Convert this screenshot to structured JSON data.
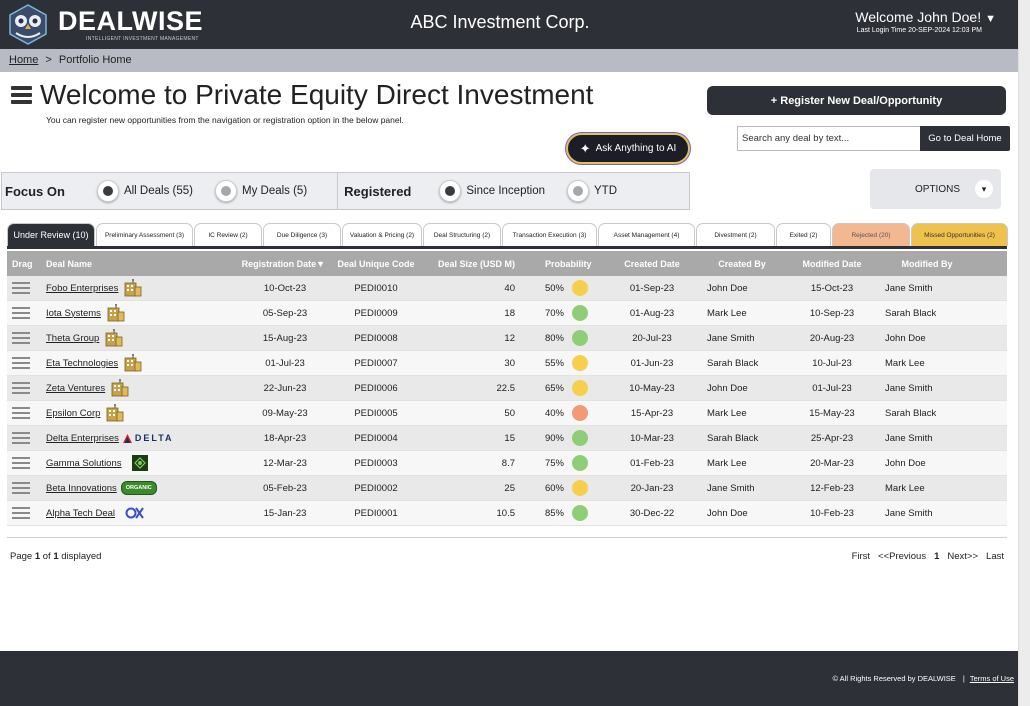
{
  "header": {
    "brand": "DEALWISE",
    "tagline": "INTELLIGENT INVESTMENT MANAGEMENT",
    "company": "ABC Investment Corp.",
    "welcome": "Welcome John Doe!",
    "last_login": "Last Login Time 20-SEP-2024 12:03 PM"
  },
  "breadcrumb": {
    "home": "Home",
    "separator": ">",
    "current": "Portfolio Home"
  },
  "page": {
    "title": "Welcome to Private Equity Direct Investment",
    "subtitle": "You can register new opportunities from the navigation or registration option in the below panel."
  },
  "actions": {
    "register": "+ Register New Deal/Opportunity",
    "search_placeholder": "Search any deal by text...",
    "goto": "Go to Deal Home",
    "ask_ai": "Ask Anything to AI",
    "options": "OPTIONS"
  },
  "filters": {
    "focus_label": "Focus On",
    "all_deals": "All Deals (55)",
    "my_deals": "My Deals (5)",
    "registered_label": "Registered",
    "since_inception": "Since Inception",
    "ytd": "YTD"
  },
  "tabs": [
    "Under Review (10)",
    "Preliminary Assessment (3)",
    "IC Review (2)",
    "Due Diligence (3)",
    "Valuation & Pricing (2)",
    "Deal Structuring (2)",
    "Transaction Execution (3)",
    "Asset Management (4)",
    "Divestment (2)",
    "Exited (2)",
    "Rejected (20)",
    "Missed Opportunities (2)"
  ],
  "table": {
    "columns": [
      "Drag",
      "Deal Name",
      "Registration Date▼",
      "Deal Unique Code",
      "Deal Size (USD M)",
      "Probability",
      "Created Date",
      "Created By",
      "Modified Date",
      "Modified By"
    ],
    "rows": [
      {
        "name": "Fobo Enterprises",
        "logo": "building-icon",
        "reg": "10-Oct-23",
        "code": "PEDI0010",
        "size": "40",
        "prob": "50%",
        "status": "#f6d04d",
        "created": "01-Sep-23",
        "created_by": "John Doe",
        "modified": "15-Oct-23",
        "modified_by": "Jane Smith"
      },
      {
        "name": "Iota Systems",
        "logo": "building-icon",
        "reg": "05-Sep-23",
        "code": "PEDI0009",
        "size": "18",
        "prob": "70%",
        "status": "#8fce77",
        "created": "01-Aug-23",
        "created_by": "Mark Lee",
        "modified": "10-Sep-23",
        "modified_by": "Sarah Black"
      },
      {
        "name": "Theta Group",
        "logo": "building-icon",
        "reg": "15-Aug-23",
        "code": "PEDI0008",
        "size": "12",
        "prob": "80%",
        "status": "#8fce77",
        "created": "20-Jul-23",
        "created_by": "Jane Smith",
        "modified": "20-Aug-23",
        "modified_by": "John Doe"
      },
      {
        "name": "Eta Technologies",
        "logo": "building-icon",
        "reg": "01-Jul-23",
        "code": "PEDI0007",
        "size": "30",
        "prob": "55%",
        "status": "#f6d04d",
        "created": "01-Jun-23",
        "created_by": "Sarah Black",
        "modified": "10-Jul-23",
        "modified_by": "Mark Lee"
      },
      {
        "name": "Zeta Ventures",
        "logo": "building-icon",
        "reg": "22-Jun-23",
        "code": "PEDI0006",
        "size": "22.5",
        "prob": "65%",
        "status": "#f6d04d",
        "created": "10-May-23",
        "created_by": "John Doe",
        "modified": "01-Jul-23",
        "modified_by": "Jane Smith"
      },
      {
        "name": "Epsilon Corp",
        "logo": "building-icon",
        "reg": "09-May-23",
        "code": "PEDI0005",
        "size": "50",
        "prob": "40%",
        "status": "#f19a74",
        "created": "15-Apr-23",
        "created_by": "Mark Lee",
        "modified": "15-May-23",
        "modified_by": "Sarah Black"
      },
      {
        "name": "Delta Enterprises",
        "logo": "delta-logo",
        "logo_text": "DELTA",
        "reg": "18-Apr-23",
        "code": "PEDI0004",
        "size": "15",
        "prob": "90%",
        "status": "#8fce77",
        "created": "10-Mar-23",
        "created_by": "Sarah Black",
        "modified": "25-Apr-23",
        "modified_by": "Jane Smith"
      },
      {
        "name": "Gamma Solutions",
        "logo": "gamma-logo",
        "reg": "12-Mar-23",
        "code": "PEDI0003",
        "size": "8.7",
        "prob": "75%",
        "status": "#8fce77",
        "created": "01-Feb-23",
        "created_by": "Mark Lee",
        "modified": "20-Mar-23",
        "modified_by": "John Doe"
      },
      {
        "name": "Beta Innovations",
        "logo": "organic-logo",
        "logo_text": "ORGANIC",
        "reg": "05-Feb-23",
        "code": "PEDI0002",
        "size": "25",
        "prob": "60%",
        "status": "#f6d04d",
        "created": "20-Jan-23",
        "created_by": "Jane Smith",
        "modified": "12-Feb-23",
        "modified_by": "Mark Lee"
      },
      {
        "name": "Alpha Tech Deal",
        "logo": "ox-logo",
        "reg": "15-Jan-23",
        "code": "PEDI0001",
        "size": "10.5",
        "prob": "85%",
        "status": "#8fce77",
        "created": "30-Dec-22",
        "created_by": "John Doe",
        "modified": "10-Feb-23",
        "modified_by": "Jane Smith"
      }
    ]
  },
  "pagination": {
    "page_prefix": "Page",
    "page_current": "1",
    "page_of": "of",
    "page_total": "1",
    "page_suffix": "displayed",
    "first": "First",
    "previous": "<<Previous",
    "current": "1",
    "next": "Next>>",
    "last": "Last"
  },
  "footer": {
    "copyright": "© All Rights Reserved by DEALWISE",
    "separator": "|",
    "terms": "Terms of Use"
  }
}
